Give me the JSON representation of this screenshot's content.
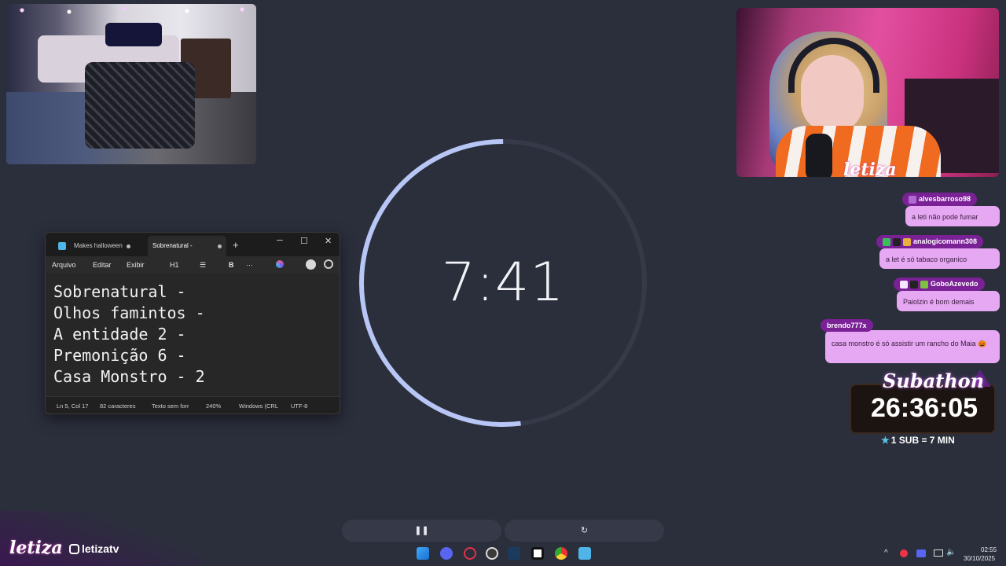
{
  "webcam_right": {
    "overlay_logo": "letiza"
  },
  "notepad": {
    "tabs": [
      {
        "label": "Makes halloween"
      },
      {
        "label": "Sobrenatural -"
      }
    ],
    "new_tab_label": "+",
    "window_buttons": {
      "minimize": "─",
      "maximize": "☐",
      "close": "✕"
    },
    "menu": {
      "file": "Arquivo",
      "edit": "Editar",
      "view": "Exibir",
      "heading": "H1",
      "list": "☰",
      "bold": "B",
      "more": "···"
    },
    "content": "Sobrenatural -\nOlhos famintos -\nA entidade 2 -\nPremonição 6 -\nCasa Monstro - 2",
    "status": {
      "position": "Ln 5, Col 17",
      "chars": "82 caracteres",
      "format": "Texto sem forr",
      "zoom": "240%",
      "line_ending": "Windows (CRL",
      "encoding": "UTF-8"
    }
  },
  "timer": {
    "display": "7:41",
    "progress_fraction": 0.52,
    "accent": "#b7c6f5",
    "track": "#353948"
  },
  "chat": {
    "messages": [
      {
        "user": "alvesbarroso98",
        "text": "a leti não pode fumar"
      },
      {
        "user": "analogicomann308",
        "text": "a let é só tabaco organico"
      },
      {
        "user": "GoboAzevedo",
        "text": "Paiolzin é bom demais"
      },
      {
        "user": "brendo777x",
        "text": "casa monstro é só assistir um rancho do Maia 🎃"
      }
    ]
  },
  "subathon": {
    "title": "Subathon",
    "time": "26:36:05",
    "rule": "1 SUB = 7 MIN"
  },
  "controls": {
    "pause": "❚❚",
    "reset": "↻"
  },
  "branding": {
    "logo": "letiza",
    "social": "letizatv"
  },
  "tray": {
    "time": "02:55",
    "date": "30/10/2025",
    "chevron": "^"
  }
}
